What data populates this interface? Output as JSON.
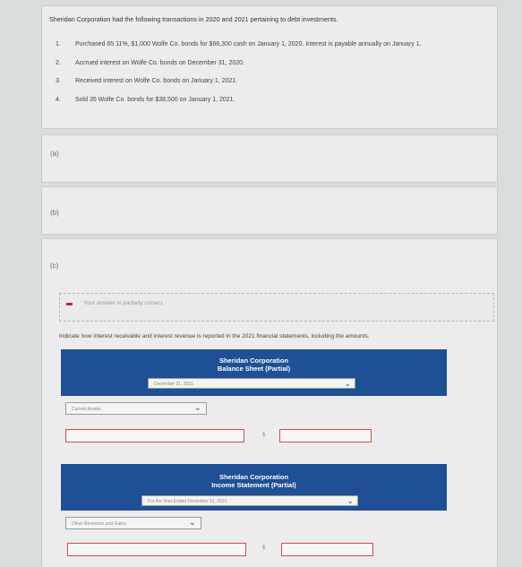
{
  "question": {
    "intro": "Sheridan Corporation had the following transactions in 2020 and 2021 pertaining to debt investments.",
    "transactions": [
      {
        "num": "1.",
        "text": "Purchased 65 11%, $1,000 Wolfe Co. bonds for $66,300 cash on January 1, 2020. Interest is payable annually on January 1."
      },
      {
        "num": "2.",
        "text": "Accrued interest on Wolfe Co. bonds on December 31, 2020."
      },
      {
        "num": "3.",
        "text": "Received interest on Wolfe Co. bonds on January 1, 2021."
      },
      {
        "num": "4.",
        "text": "Sold 35 Wolfe Co. bonds for $38,500 on January 1, 2021."
      }
    ]
  },
  "parts": {
    "a": "(a)",
    "b": "(b)",
    "c": "(c)"
  },
  "feedback": {
    "message": "Your answer is partially correct."
  },
  "instruction": "Indicate how interest receivable and interest revenue is reported in the 2021 financial statements, including the amounts.",
  "balance_sheet": {
    "company": "Sheridan Corporation",
    "title": "Balance Sheet (Partial)",
    "date_select": "December 31, 2021",
    "section_select": "Current Assets",
    "currency": "$"
  },
  "income_statement": {
    "company": "Sheridan Corporation",
    "title": "Income Statement (Partial)",
    "date_select": "For the Year Ended December 31, 2021",
    "section_select": "Other Revenues and Gains",
    "currency": "$"
  },
  "colors": {
    "header": "#1f4f94",
    "error_border": "#d24b4b",
    "feedback_dash": "#cc2233"
  }
}
